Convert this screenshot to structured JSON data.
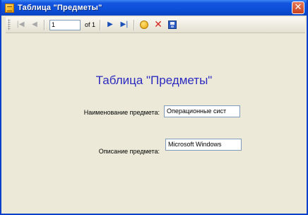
{
  "window": {
    "title": "Таблица \"Предметы\"",
    "close_glyph": "✕"
  },
  "toolbar": {
    "first_glyph": "|◀",
    "prev_glyph": "◀",
    "position_value": "1",
    "of_label": "of 1",
    "next_glyph": "▶",
    "last_glyph": "▶|",
    "delete_glyph": "✕",
    "icons": [
      "move-first-icon",
      "move-previous-icon",
      "move-next-icon",
      "move-last-icon",
      "add-new-icon",
      "delete-icon",
      "save-icon"
    ]
  },
  "form": {
    "heading": "Таблица \"Предметы\"",
    "name_label": "Наименование предмета:",
    "name_value": "Операционные сист",
    "description_label": "Описание предмета:",
    "description_value": "Microsoft Windows"
  },
  "colors": {
    "titlebar": "#0c4fd8",
    "window_bg": "#ece9d8",
    "heading": "#2b2bc0",
    "close_button": "#c9421e",
    "delete_icon": "#d8261c"
  }
}
